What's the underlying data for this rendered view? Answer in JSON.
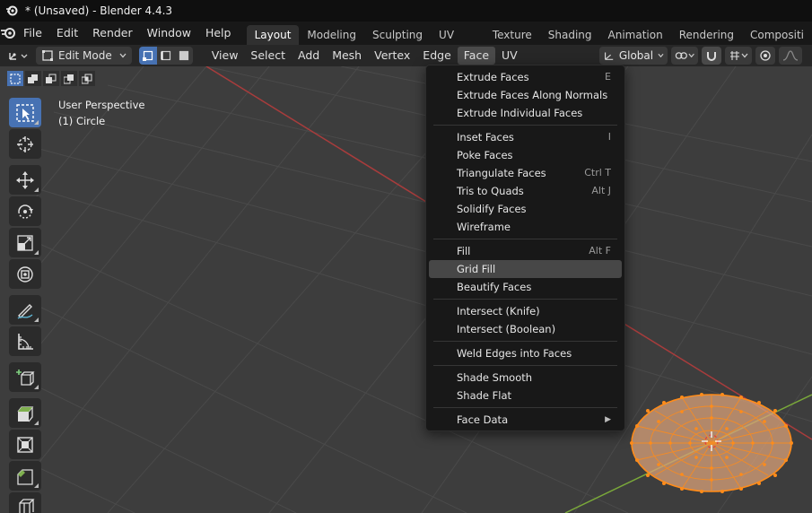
{
  "window": {
    "title": "* (Unsaved) - Blender 4.4.3"
  },
  "topmenu": [
    "File",
    "Edit",
    "Render",
    "Window",
    "Help"
  ],
  "workspaces": [
    {
      "label": "Layout",
      "active": true
    },
    {
      "label": "Modeling",
      "active": false
    },
    {
      "label": "Sculpting",
      "active": false
    },
    {
      "label": "UV Editing",
      "active": false
    },
    {
      "label": "Texture Paint",
      "active": false
    },
    {
      "label": "Shading",
      "active": false
    },
    {
      "label": "Animation",
      "active": false
    },
    {
      "label": "Rendering",
      "active": false
    },
    {
      "label": "Compositi",
      "active": false
    }
  ],
  "header": {
    "mode": "Edit Mode",
    "menus": [
      "View",
      "Select",
      "Add",
      "Mesh",
      "Vertex",
      "Edge",
      "Face",
      "UV"
    ],
    "open_menu": "Face",
    "transform_orientation": "Global"
  },
  "viewport": {
    "perspective": "User Perspective",
    "object": "(1) Circle"
  },
  "face_menu": {
    "groups": [
      [
        {
          "label": "Extrude Faces",
          "shortcut": "E"
        },
        {
          "label": "Extrude Faces Along Normals",
          "shortcut": ""
        },
        {
          "label": "Extrude Individual Faces",
          "shortcut": ""
        }
      ],
      [
        {
          "label": "Inset Faces",
          "shortcut": "I"
        },
        {
          "label": "Poke Faces",
          "shortcut": ""
        },
        {
          "label": "Triangulate Faces",
          "shortcut": "Ctrl T"
        },
        {
          "label": "Tris to Quads",
          "shortcut": "Alt J"
        },
        {
          "label": "Solidify Faces",
          "shortcut": ""
        },
        {
          "label": "Wireframe",
          "shortcut": ""
        }
      ],
      [
        {
          "label": "Fill",
          "shortcut": "Alt F"
        },
        {
          "label": "Grid Fill",
          "shortcut": "",
          "highlighted": true
        },
        {
          "label": "Beautify Faces",
          "shortcut": ""
        }
      ],
      [
        {
          "label": "Intersect (Knife)",
          "shortcut": ""
        },
        {
          "label": "Intersect (Boolean)",
          "shortcut": ""
        }
      ],
      [
        {
          "label": "Weld Edges into Faces",
          "shortcut": ""
        }
      ],
      [
        {
          "label": "Shade Smooth",
          "shortcut": ""
        },
        {
          "label": "Shade Flat",
          "shortcut": ""
        }
      ],
      [
        {
          "label": "Face Data",
          "shortcut": "",
          "submenu": true
        }
      ]
    ]
  },
  "colors": {
    "accent": "#4772b3",
    "mesh_fill": "#e0a070",
    "vertex": "#ff8c1a",
    "x_axis": "#a83c3c",
    "y_axis": "#7aa83a"
  }
}
